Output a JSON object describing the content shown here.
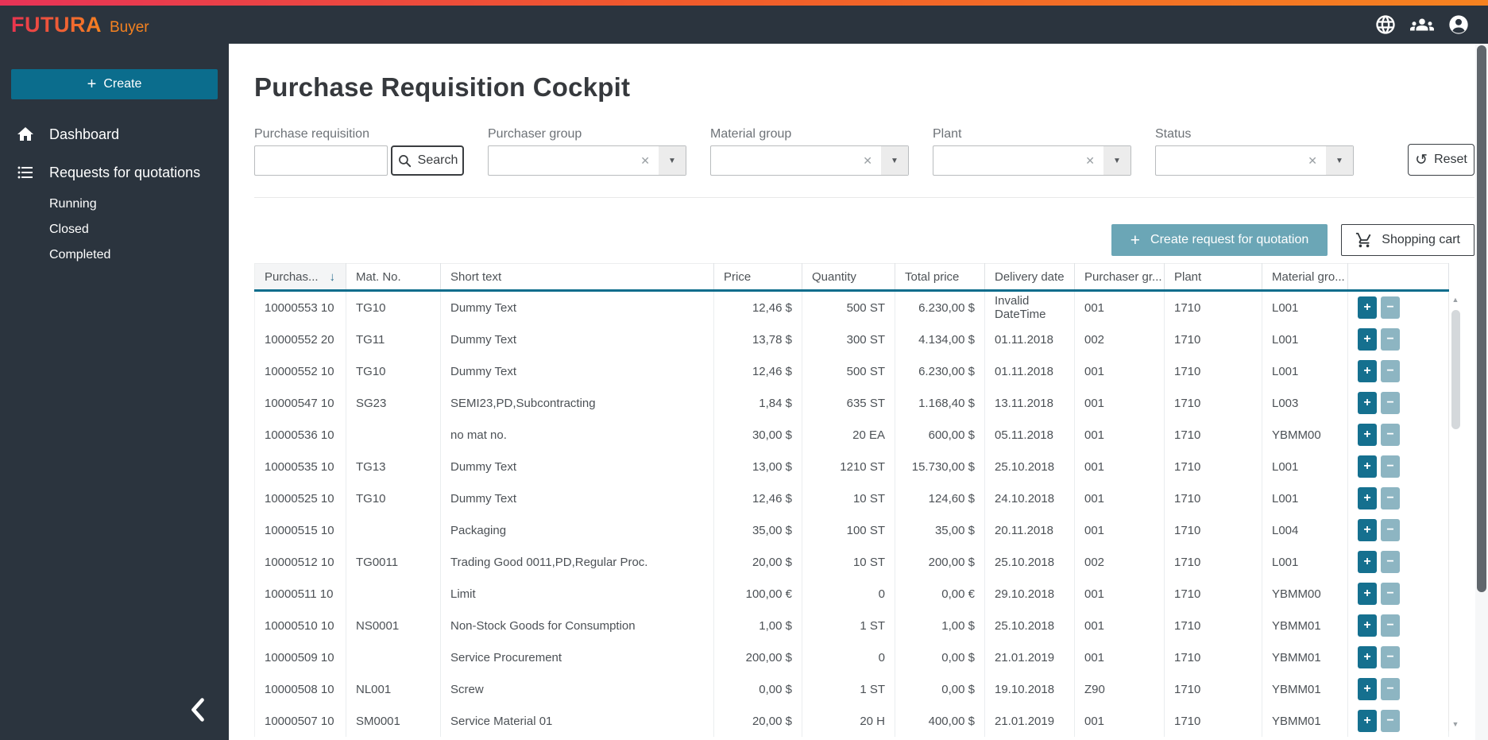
{
  "brand": {
    "name": "FUTURA",
    "product": "Buyer"
  },
  "header": {
    "icons": [
      "language-icon",
      "groups-icon",
      "account-circle-icon"
    ]
  },
  "sidebar": {
    "create_button": "Create",
    "items": [
      {
        "label": "Dashboard",
        "icon": "home-icon"
      },
      {
        "label": "Requests for quotations",
        "icon": "list-icon"
      }
    ],
    "sub_items": [
      "Running",
      "Closed",
      "Completed"
    ]
  },
  "page": {
    "title": "Purchase Requisition Cockpit",
    "filters": {
      "purchase_requisition_label": "Purchase requisition",
      "search_button": "Search",
      "combos": [
        {
          "label": "Purchaser group",
          "value": ""
        },
        {
          "label": "Material group",
          "value": ""
        },
        {
          "label": "Plant",
          "value": ""
        },
        {
          "label": "Status",
          "value": ""
        }
      ],
      "reset_button": "Reset"
    },
    "actions": {
      "create_rfq_button": "Create request for quotation",
      "shopping_cart_button": "Shopping cart"
    }
  },
  "table": {
    "columns": [
      {
        "key": "id",
        "label": "Purchas...",
        "sorted": "desc"
      },
      {
        "key": "mat",
        "label": "Mat. No."
      },
      {
        "key": "text",
        "label": "Short text"
      },
      {
        "key": "price",
        "label": "Price"
      },
      {
        "key": "qty",
        "label": "Quantity"
      },
      {
        "key": "total",
        "label": "Total price"
      },
      {
        "key": "date",
        "label": "Delivery date"
      },
      {
        "key": "pgrp",
        "label": "Purchaser gr..."
      },
      {
        "key": "plant",
        "label": "Plant"
      },
      {
        "key": "mgrp",
        "label": "Material gro..."
      },
      {
        "key": "actions",
        "label": ""
      }
    ],
    "rows": [
      {
        "id": "10000553 10",
        "mat": "TG10",
        "text": "Dummy Text",
        "price": "12,46 $",
        "qty": "500 ST",
        "total": "6.230,00 $",
        "date": "Invalid DateTime",
        "pgrp": "001",
        "plant": "1710",
        "mgrp": "L001"
      },
      {
        "id": "10000552 20",
        "mat": "TG11",
        "text": "Dummy Text",
        "price": "13,78 $",
        "qty": "300 ST",
        "total": "4.134,00 $",
        "date": "01.11.2018",
        "pgrp": "002",
        "plant": "1710",
        "mgrp": "L001"
      },
      {
        "id": "10000552 10",
        "mat": "TG10",
        "text": "Dummy Text",
        "price": "12,46 $",
        "qty": "500 ST",
        "total": "6.230,00 $",
        "date": "01.11.2018",
        "pgrp": "001",
        "plant": "1710",
        "mgrp": "L001"
      },
      {
        "id": "10000547 10",
        "mat": "SG23",
        "text": "SEMI23,PD,Subcontracting",
        "price": "1,84 $",
        "qty": "635 ST",
        "total": "1.168,40 $",
        "date": "13.11.2018",
        "pgrp": "001",
        "plant": "1710",
        "mgrp": "L003"
      },
      {
        "id": "10000536 10",
        "mat": "",
        "text": "no mat no.",
        "price": "30,00 $",
        "qty": "20 EA",
        "total": "600,00 $",
        "date": "05.11.2018",
        "pgrp": "001",
        "plant": "1710",
        "mgrp": "YBMM00"
      },
      {
        "id": "10000535 10",
        "mat": "TG13",
        "text": "Dummy Text",
        "price": "13,00 $",
        "qty": "1210 ST",
        "total": "15.730,00 $",
        "date": "25.10.2018",
        "pgrp": "001",
        "plant": "1710",
        "mgrp": "L001"
      },
      {
        "id": "10000525 10",
        "mat": "TG10",
        "text": "Dummy Text",
        "price": "12,46 $",
        "qty": "10 ST",
        "total": "124,60 $",
        "date": "24.10.2018",
        "pgrp": "001",
        "plant": "1710",
        "mgrp": "L001"
      },
      {
        "id": "10000515 10",
        "mat": "",
        "text": "Packaging",
        "price": "35,00 $",
        "qty": "100 ST",
        "total": "35,00 $",
        "date": "20.11.2018",
        "pgrp": "001",
        "plant": "1710",
        "mgrp": "L004"
      },
      {
        "id": "10000512 10",
        "mat": "TG0011",
        "text": "Trading Good 0011,PD,Regular Proc.",
        "price": "20,00 $",
        "qty": "10 ST",
        "total": "200,00 $",
        "date": "25.10.2018",
        "pgrp": "002",
        "plant": "1710",
        "mgrp": "L001"
      },
      {
        "id": "10000511 10",
        "mat": "",
        "text": "Limit",
        "price": "100,00 €",
        "qty": "0",
        "total": "0,00 €",
        "date": "29.10.2018",
        "pgrp": "001",
        "plant": "1710",
        "mgrp": "YBMM00"
      },
      {
        "id": "10000510 10",
        "mat": "NS0001",
        "text": "Non-Stock Goods for Consumption",
        "price": "1,00 $",
        "qty": "1 ST",
        "total": "1,00 $",
        "date": "25.10.2018",
        "pgrp": "001",
        "plant": "1710",
        "mgrp": "YBMM01"
      },
      {
        "id": "10000509 10",
        "mat": "",
        "text": "Service Procurement",
        "price": "200,00 $",
        "qty": "0",
        "total": "0,00 $",
        "date": "21.01.2019",
        "pgrp": "001",
        "plant": "1710",
        "mgrp": "YBMM01"
      },
      {
        "id": "10000508 10",
        "mat": "NL001",
        "text": "Screw",
        "price": "0,00 $",
        "qty": "1 ST",
        "total": "0,00 $",
        "date": "19.10.2018",
        "pgrp": "Z90",
        "plant": "1710",
        "mgrp": "YBMM01"
      },
      {
        "id": "10000507 10",
        "mat": "SM0001",
        "text": "Service Material 01",
        "price": "20,00 $",
        "qty": "20 H",
        "total": "400,00 $",
        "date": "21.01.2019",
        "pgrp": "001",
        "plant": "1710",
        "mgrp": "YBMM01"
      }
    ]
  },
  "icons": {
    "create_plus": "+",
    "rfq_plus": "+",
    "reset": "↺",
    "clear": "✕",
    "dropdown": "▼",
    "sort_desc": "↓",
    "add": "+",
    "remove": "−",
    "scroll_up": "▲",
    "scroll_down": "▼"
  },
  "colors": {
    "topbar_bg": "#2b343e",
    "gradient_left": "#e73357",
    "gradient_right": "#f58220",
    "brand_orange": "#f58220",
    "create_button_teal": "#0b6d8d",
    "rfq_button_teal": "#6ba6b6",
    "table_header_underline": "#0c6d8c",
    "add_button": "#15708f",
    "remove_button": "#8db5c2"
  }
}
